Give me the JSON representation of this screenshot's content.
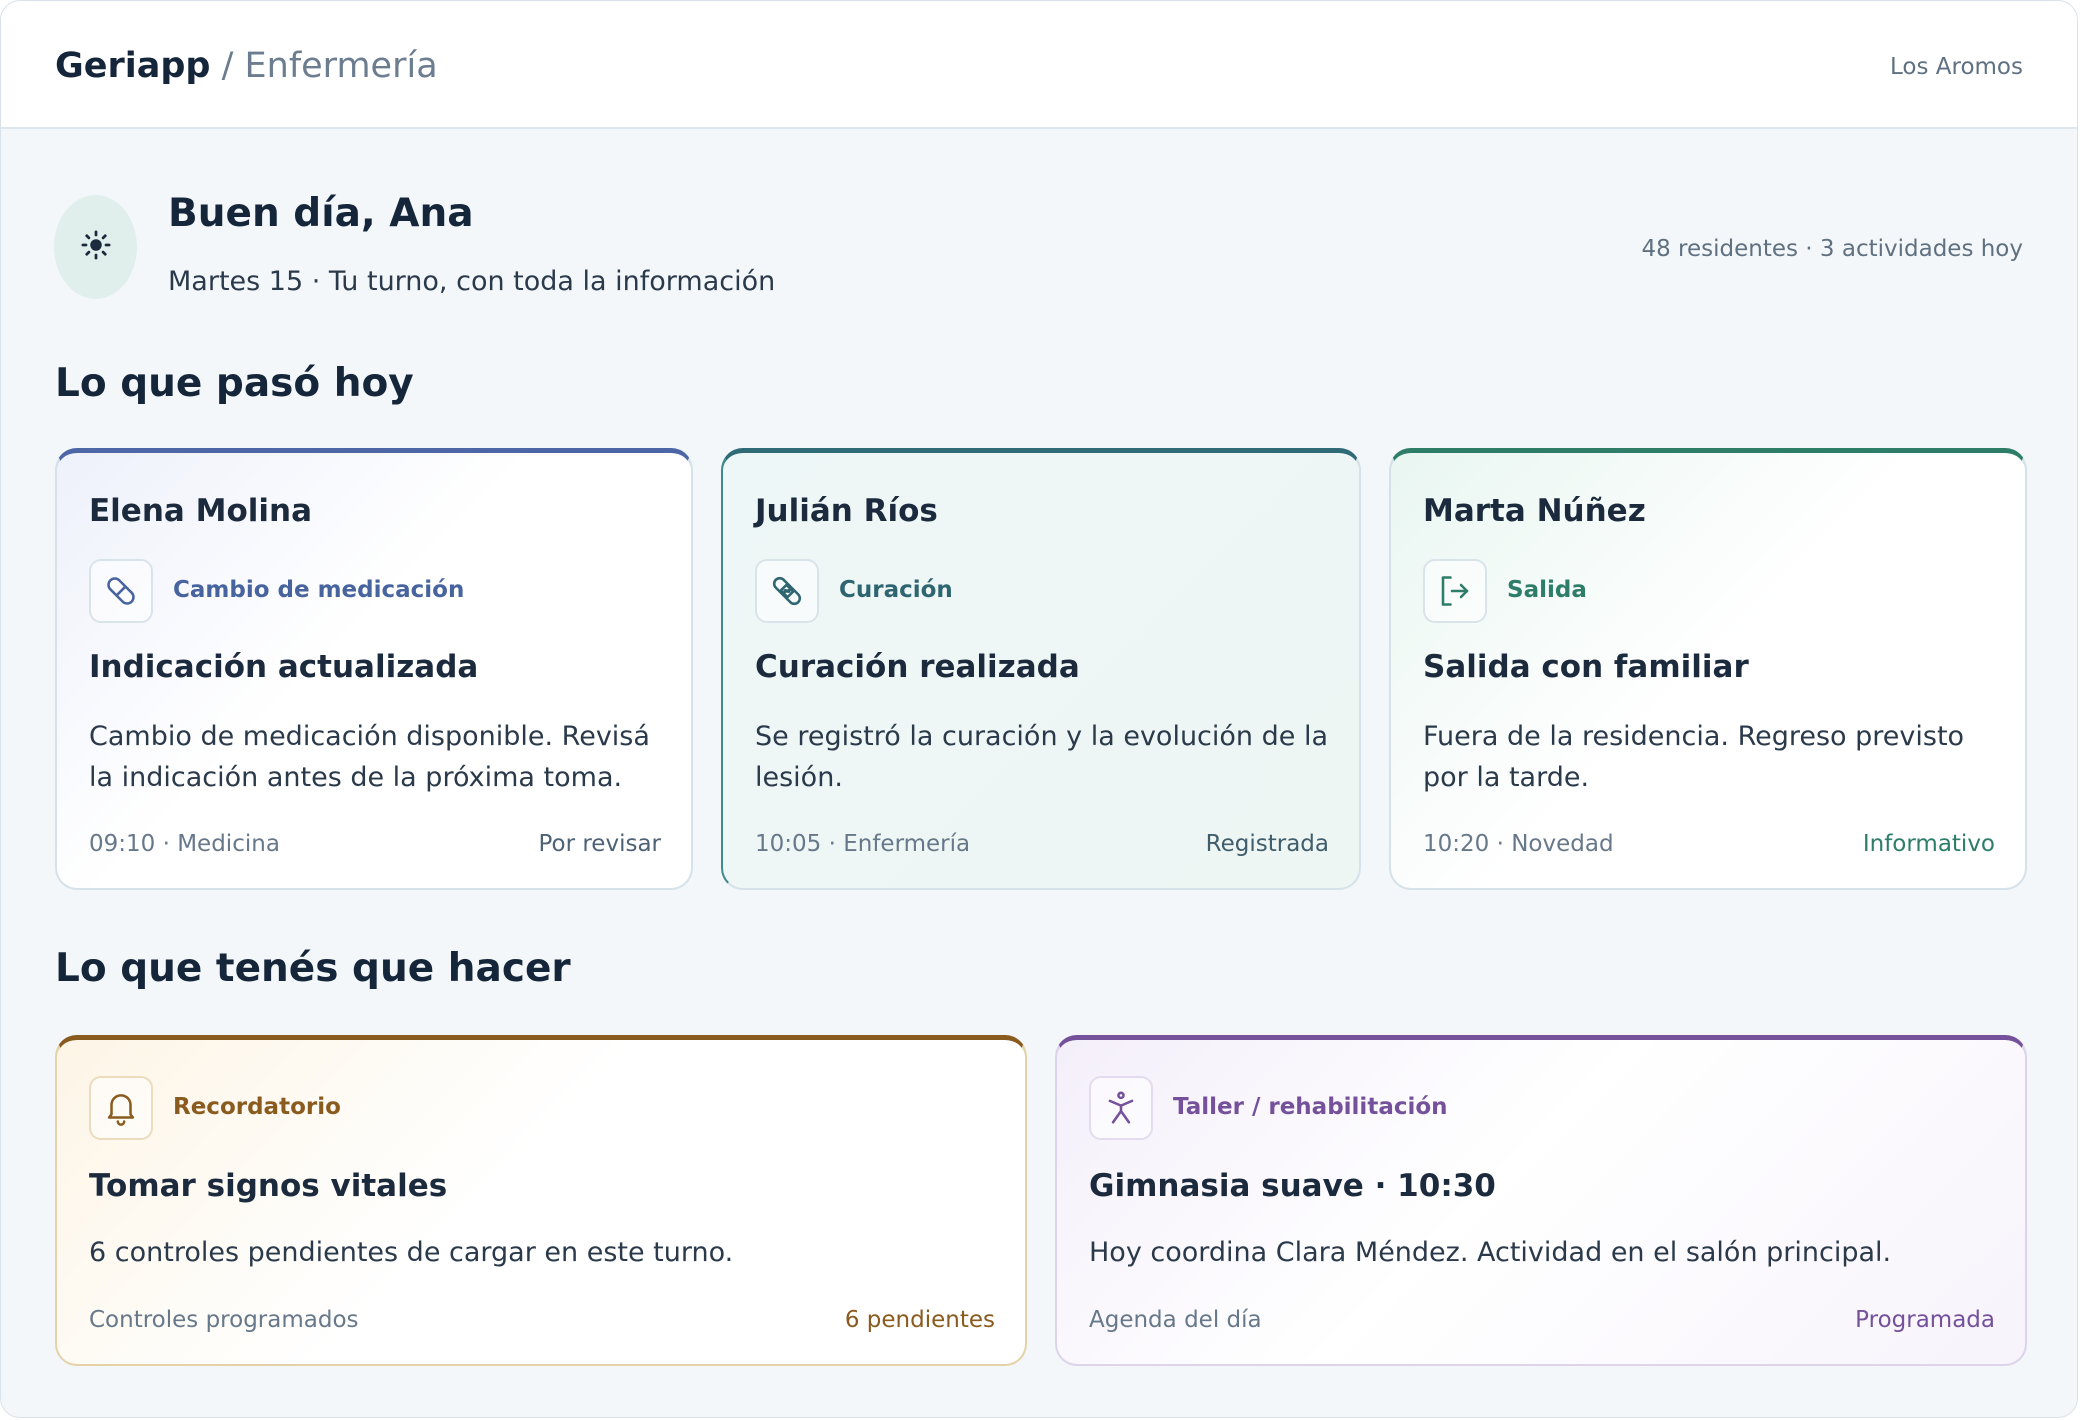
{
  "header": {
    "app_name": "Geriapp",
    "separator": "/",
    "section": "Enfermería",
    "facility": "Los Aromos"
  },
  "greeting": {
    "icon": "sun-icon",
    "title": "Buen día, Ana",
    "subtitle": "Martes 15 · Tu turno, con toda la información",
    "stats": "48 residentes · 3 actividades hoy"
  },
  "today": {
    "title": "Lo que pasó hoy",
    "cards": [
      {
        "resident": "Elena Molina",
        "icon": "pill-icon",
        "category": "Cambio de medicación",
        "headline": "Indicación actualizada",
        "description": "Cambio de medicación disponible. Revisá la indicación antes de la próxima toma.",
        "meta": "09:10 · Medicina",
        "status": "Por revisar",
        "accent": "#4d67a6"
      },
      {
        "resident": "Julián Ríos",
        "icon": "bandage-icon",
        "category": "Curación",
        "headline": "Curación realizada",
        "description": "Se registró la curación y la evolución de la lesión.",
        "meta": "10:05 · Enfermería",
        "status": "Registrada",
        "accent": "#2f6a77"
      },
      {
        "resident": "Marta Núñez",
        "icon": "exit-icon",
        "category": "Salida",
        "headline": "Salida con familiar",
        "description": "Fuera de la residencia. Regreso previsto por la tarde.",
        "meta": "10:20 · Novedad",
        "status": "Informativo",
        "accent": "#2d7d68"
      }
    ]
  },
  "todo": {
    "title": "Lo que tenés que hacer",
    "cards": [
      {
        "icon": "bell-icon",
        "category": "Recordatorio",
        "headline": "Tomar signos vitales",
        "description": "6 controles pendientes de cargar en este turno.",
        "meta": "Controles programados",
        "status": "6 pendientes",
        "accent": "#8a5b1e"
      },
      {
        "icon": "person-exercise-icon",
        "category": "Taller / rehabilitación",
        "headline": "Gimnasia suave · 10:30",
        "description": "Hoy coordina Clara Méndez. Actividad en el salón principal.",
        "meta": "Agenda del día",
        "status": "Programada",
        "accent": "#74519a"
      }
    ]
  }
}
